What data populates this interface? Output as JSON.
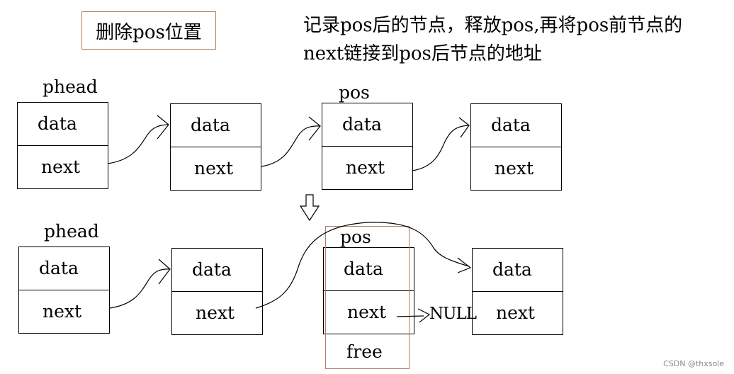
{
  "title": "删除pos位置",
  "description": {
    "line1": "记录pos后的节点，释放pos,再将pos前节点的",
    "line2": "next链接到pos后节点的地址"
  },
  "before": {
    "phead_label": "phead",
    "pos_label": "pos",
    "nodes": [
      {
        "data": "data",
        "next": "next"
      },
      {
        "data": "data",
        "next": "next"
      },
      {
        "data": "data",
        "next": "next"
      },
      {
        "data": "data",
        "next": "next"
      }
    ]
  },
  "after": {
    "phead_label": "phead",
    "pos_label": "pos",
    "null_label": "NULL",
    "free_label": "free",
    "nodes": [
      {
        "data": "data",
        "next": "next"
      },
      {
        "data": "data",
        "next": "next"
      },
      {
        "data": "data",
        "next": "next"
      },
      {
        "data": "data",
        "next": "next"
      }
    ]
  },
  "colors": {
    "accent_border": "#b07f5f",
    "line": "#000000",
    "watermark": "#8a8a8a"
  },
  "watermark": "CSDN @thxsole"
}
